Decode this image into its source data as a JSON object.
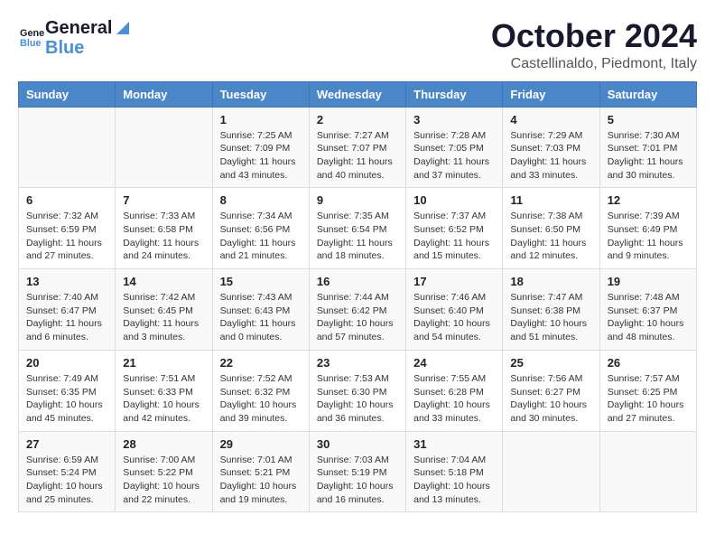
{
  "header": {
    "logo_general": "General",
    "logo_blue": "Blue",
    "month_title": "October 2024",
    "location": "Castellinaldo, Piedmont, Italy"
  },
  "days_of_week": [
    "Sunday",
    "Monday",
    "Tuesday",
    "Wednesday",
    "Thursday",
    "Friday",
    "Saturday"
  ],
  "weeks": [
    [
      {
        "day": "",
        "info": ""
      },
      {
        "day": "",
        "info": ""
      },
      {
        "day": "1",
        "info": "Sunrise: 7:25 AM\nSunset: 7:09 PM\nDaylight: 11 hours and 43 minutes."
      },
      {
        "day": "2",
        "info": "Sunrise: 7:27 AM\nSunset: 7:07 PM\nDaylight: 11 hours and 40 minutes."
      },
      {
        "day": "3",
        "info": "Sunrise: 7:28 AM\nSunset: 7:05 PM\nDaylight: 11 hours and 37 minutes."
      },
      {
        "day": "4",
        "info": "Sunrise: 7:29 AM\nSunset: 7:03 PM\nDaylight: 11 hours and 33 minutes."
      },
      {
        "day": "5",
        "info": "Sunrise: 7:30 AM\nSunset: 7:01 PM\nDaylight: 11 hours and 30 minutes."
      }
    ],
    [
      {
        "day": "6",
        "info": "Sunrise: 7:32 AM\nSunset: 6:59 PM\nDaylight: 11 hours and 27 minutes."
      },
      {
        "day": "7",
        "info": "Sunrise: 7:33 AM\nSunset: 6:58 PM\nDaylight: 11 hours and 24 minutes."
      },
      {
        "day": "8",
        "info": "Sunrise: 7:34 AM\nSunset: 6:56 PM\nDaylight: 11 hours and 21 minutes."
      },
      {
        "day": "9",
        "info": "Sunrise: 7:35 AM\nSunset: 6:54 PM\nDaylight: 11 hours and 18 minutes."
      },
      {
        "day": "10",
        "info": "Sunrise: 7:37 AM\nSunset: 6:52 PM\nDaylight: 11 hours and 15 minutes."
      },
      {
        "day": "11",
        "info": "Sunrise: 7:38 AM\nSunset: 6:50 PM\nDaylight: 11 hours and 12 minutes."
      },
      {
        "day": "12",
        "info": "Sunrise: 7:39 AM\nSunset: 6:49 PM\nDaylight: 11 hours and 9 minutes."
      }
    ],
    [
      {
        "day": "13",
        "info": "Sunrise: 7:40 AM\nSunset: 6:47 PM\nDaylight: 11 hours and 6 minutes."
      },
      {
        "day": "14",
        "info": "Sunrise: 7:42 AM\nSunset: 6:45 PM\nDaylight: 11 hours and 3 minutes."
      },
      {
        "day": "15",
        "info": "Sunrise: 7:43 AM\nSunset: 6:43 PM\nDaylight: 11 hours and 0 minutes."
      },
      {
        "day": "16",
        "info": "Sunrise: 7:44 AM\nSunset: 6:42 PM\nDaylight: 10 hours and 57 minutes."
      },
      {
        "day": "17",
        "info": "Sunrise: 7:46 AM\nSunset: 6:40 PM\nDaylight: 10 hours and 54 minutes."
      },
      {
        "day": "18",
        "info": "Sunrise: 7:47 AM\nSunset: 6:38 PM\nDaylight: 10 hours and 51 minutes."
      },
      {
        "day": "19",
        "info": "Sunrise: 7:48 AM\nSunset: 6:37 PM\nDaylight: 10 hours and 48 minutes."
      }
    ],
    [
      {
        "day": "20",
        "info": "Sunrise: 7:49 AM\nSunset: 6:35 PM\nDaylight: 10 hours and 45 minutes."
      },
      {
        "day": "21",
        "info": "Sunrise: 7:51 AM\nSunset: 6:33 PM\nDaylight: 10 hours and 42 minutes."
      },
      {
        "day": "22",
        "info": "Sunrise: 7:52 AM\nSunset: 6:32 PM\nDaylight: 10 hours and 39 minutes."
      },
      {
        "day": "23",
        "info": "Sunrise: 7:53 AM\nSunset: 6:30 PM\nDaylight: 10 hours and 36 minutes."
      },
      {
        "day": "24",
        "info": "Sunrise: 7:55 AM\nSunset: 6:28 PM\nDaylight: 10 hours and 33 minutes."
      },
      {
        "day": "25",
        "info": "Sunrise: 7:56 AM\nSunset: 6:27 PM\nDaylight: 10 hours and 30 minutes."
      },
      {
        "day": "26",
        "info": "Sunrise: 7:57 AM\nSunset: 6:25 PM\nDaylight: 10 hours and 27 minutes."
      }
    ],
    [
      {
        "day": "27",
        "info": "Sunrise: 6:59 AM\nSunset: 5:24 PM\nDaylight: 10 hours and 25 minutes."
      },
      {
        "day": "28",
        "info": "Sunrise: 7:00 AM\nSunset: 5:22 PM\nDaylight: 10 hours and 22 minutes."
      },
      {
        "day": "29",
        "info": "Sunrise: 7:01 AM\nSunset: 5:21 PM\nDaylight: 10 hours and 19 minutes."
      },
      {
        "day": "30",
        "info": "Sunrise: 7:03 AM\nSunset: 5:19 PM\nDaylight: 10 hours and 16 minutes."
      },
      {
        "day": "31",
        "info": "Sunrise: 7:04 AM\nSunset: 5:18 PM\nDaylight: 10 hours and 13 minutes."
      },
      {
        "day": "",
        "info": ""
      },
      {
        "day": "",
        "info": ""
      }
    ]
  ]
}
